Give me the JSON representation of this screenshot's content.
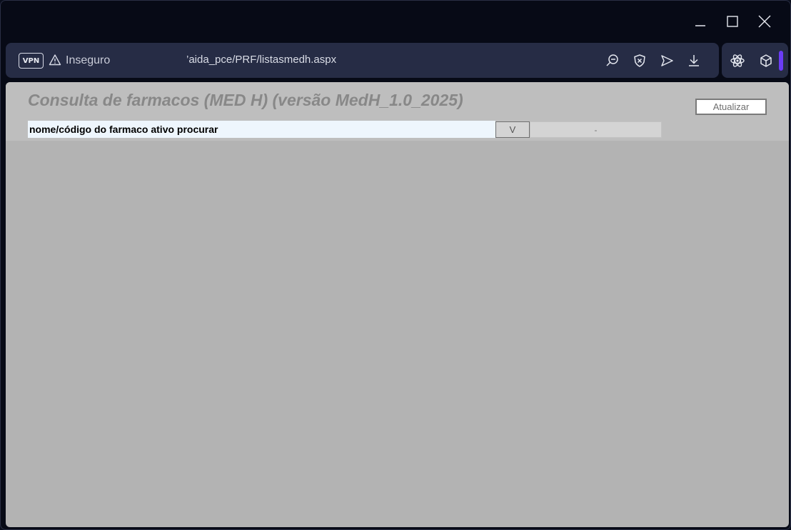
{
  "browser": {
    "vpn_label": "VPN",
    "security_label": "Inseguro",
    "url": "’aida_pce/PRF/listasmedh.aspx",
    "address_icons": [
      "zoom-out-icon",
      "shield-x-icon",
      "send-icon",
      "download-icon"
    ],
    "extension_icons": [
      "atom-icon",
      "cube-icon"
    ],
    "accent_color": "#6b3cf5"
  },
  "window_controls": [
    "minimize-icon",
    "maximize-icon",
    "close-icon"
  ],
  "page": {
    "title": "Consulta de farmacos (MED H) (versão MedH_1.0_2025)",
    "refresh_button": "Atualizar",
    "search_value": "nome/código do farmaco ativo procurar",
    "v_button": "V",
    "dash_field": "-"
  }
}
